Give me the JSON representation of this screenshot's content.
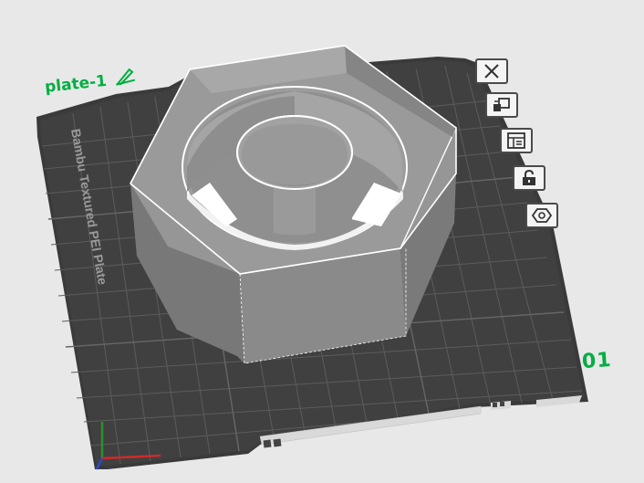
{
  "plate": {
    "name": "plate-1",
    "number": "01",
    "bed_text": "Bambu Textured PEI Plate"
  },
  "toolbar": {
    "buttons": [
      {
        "name": "remove-plate-button",
        "icon": "close-icon"
      },
      {
        "name": "arrange-button",
        "icon": "arrange-icon"
      },
      {
        "name": "plate-settings-button",
        "icon": "plate-layout-icon"
      },
      {
        "name": "lock-plate-button",
        "icon": "unlock-icon"
      },
      {
        "name": "plate-object-button",
        "icon": "hexagon-icon"
      }
    ]
  },
  "colors": {
    "accent": "#00ae42",
    "bed": "#3f3f3f",
    "grid": "#5a5a5a",
    "model": "#8c8c8c",
    "background": "#e8e8e8"
  }
}
